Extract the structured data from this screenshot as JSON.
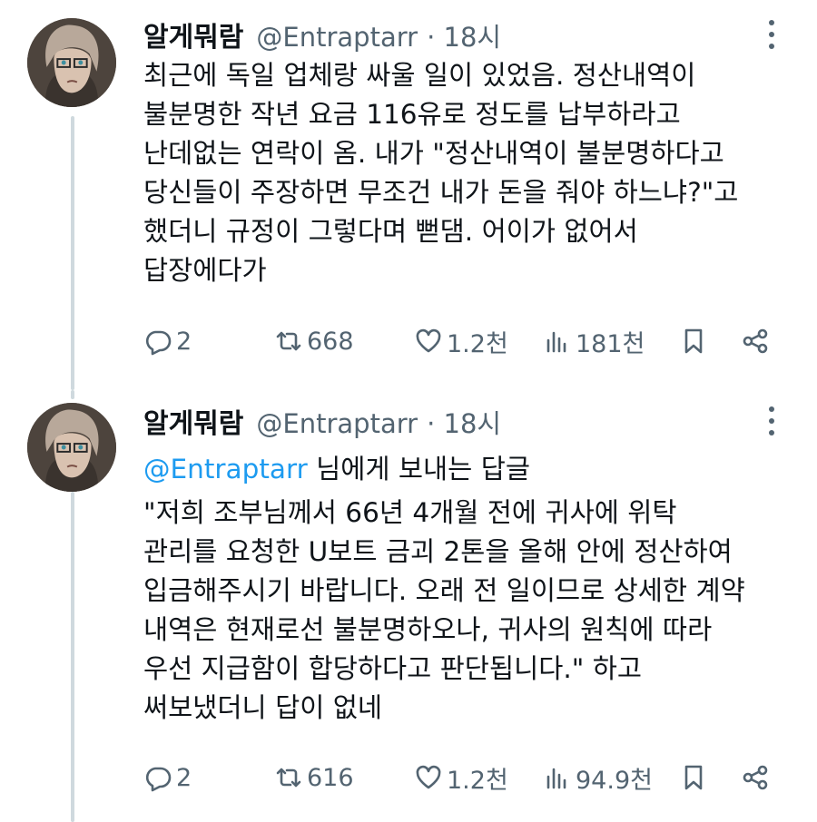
{
  "tweets": [
    {
      "display_name": "알게뭐람",
      "handle": "@Entraptarr",
      "time": "· 18시",
      "lines": [
        "최근에 독일 업체랑 싸울 일이 있었음. 정산내역이",
        "불분명한 작년 요금 116유로 정도를 납부하라고",
        "난데없는 연락이 옴. 내가 \"정산내역이 불분명하다고",
        "당신들이 주장하면 무조건 내가 돈을 줘야 하느냐?\"고",
        "했더니 규정이 그렇다며 뻗댐. 어이가 없어서",
        "답장에다가"
      ],
      "stats": {
        "replies": "2",
        "retweets": "668",
        "likes": "1.2천",
        "views": "181천"
      }
    },
    {
      "display_name": "알게뭐람",
      "handle": "@Entraptarr",
      "time": "· 18시",
      "reply_mention": "@Entraptarr",
      "reply_suffix": " 님에게 보내는 답글",
      "lines": [
        "\"저희 조부님께서 66년 4개월 전에 귀사에 위탁",
        "관리를 요청한 U보트 금괴 2톤을 올해 안에 정산하여",
        "입금해주시기 바랍니다. 오래 전 일이므로 상세한 계약",
        "내역은 현재로선 불분명하오나, 귀사의 원칙에 따라",
        "우선 지급함이 합당하다고 판단됩니다.\" 하고",
        "써보냈더니 답이 없네"
      ],
      "stats": {
        "replies": "2",
        "retweets": "616",
        "likes": "1.2천",
        "views": "94.9천"
      }
    }
  ],
  "icons": {
    "reply": "speech-bubble-icon",
    "retweet": "retweet-icon",
    "like": "heart-icon",
    "views": "bar-chart-icon",
    "bookmark": "bookmark-icon",
    "share": "share-icon",
    "more": "vertical-ellipsis-icon"
  },
  "colors": {
    "text": "#0f1419",
    "secondary": "#536471",
    "link": "#1d9bf0",
    "thread_line": "#cfd9de"
  }
}
